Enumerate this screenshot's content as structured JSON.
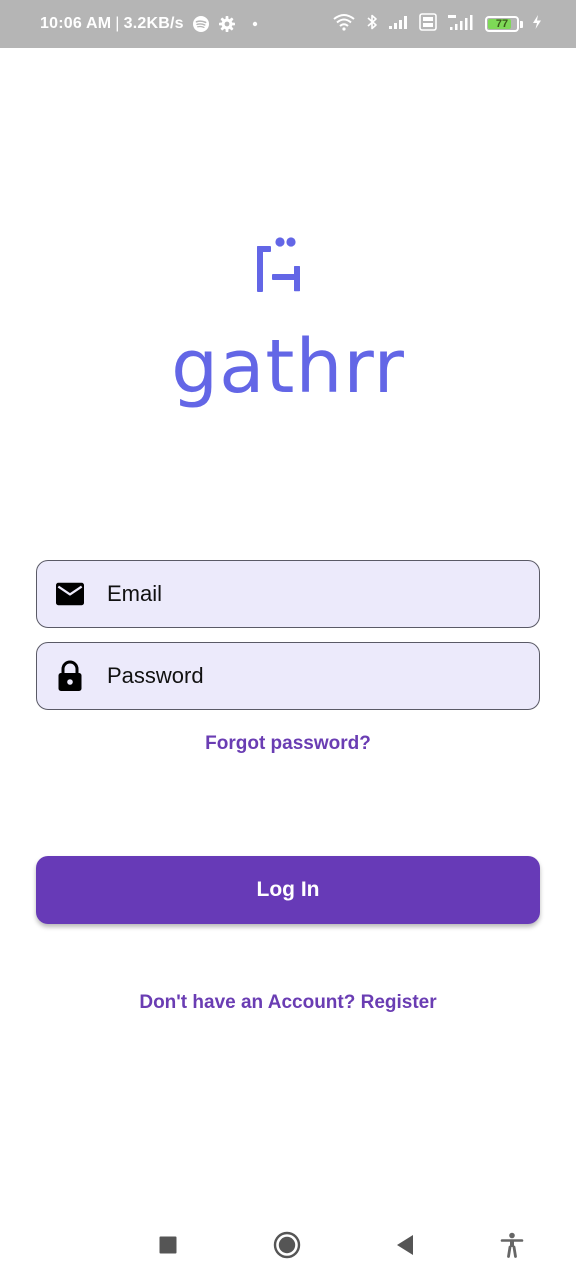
{
  "status_bar": {
    "time": "10:06 AM",
    "separator": "|",
    "net_speed": "3.2KB/s",
    "battery_level": "77",
    "left_icons": [
      "spotify-icon",
      "gear-icon",
      "dot-icon"
    ],
    "right_icons": [
      "wifi-icon",
      "bluetooth-icon",
      "signal-icon",
      "volte-icon",
      "signal-4g-icon",
      "battery-icon",
      "charging-icon"
    ],
    "colors": {
      "background": "#b5b5b5",
      "battery_fill": "#7ed957"
    }
  },
  "logo": {
    "wordmark": "gathrr",
    "icon": "gathrr-logo-mark",
    "color": "#6366e6"
  },
  "form": {
    "email": {
      "placeholder": "Email",
      "value": "",
      "icon": "mail-icon"
    },
    "password": {
      "placeholder": "Password",
      "value": "",
      "icon": "lock-icon"
    },
    "field_background": "#eceafb"
  },
  "forgot_password_label": "Forgot password?",
  "login_button": {
    "label": "Log In",
    "color": "#673ab7"
  },
  "register_link": "Don't have an Account? Register",
  "nav_bar": {
    "icons": [
      "recents-square-icon",
      "home-circle-icon",
      "back-triangle-icon",
      "accessibility-icon"
    ]
  }
}
